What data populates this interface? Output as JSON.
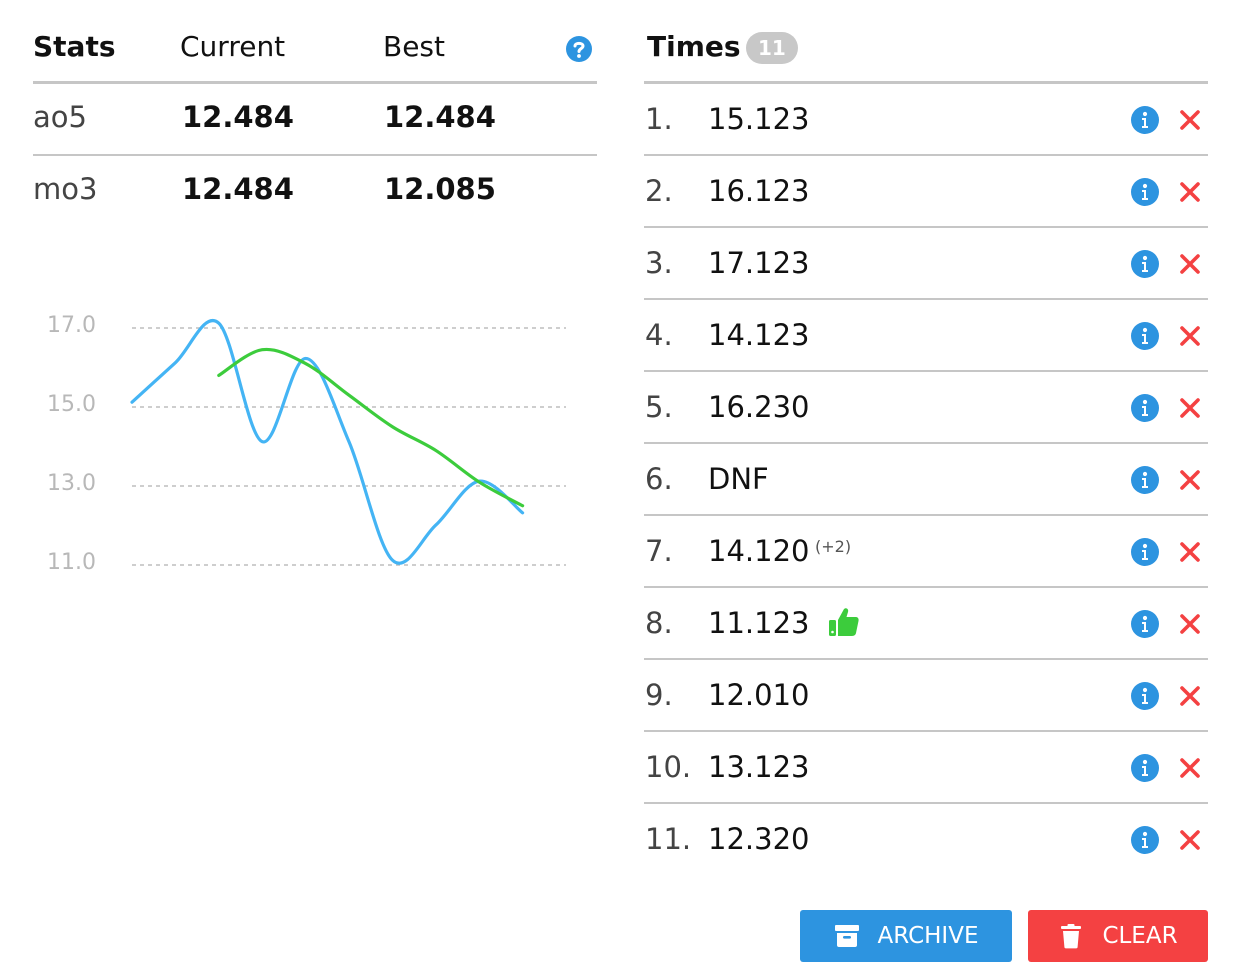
{
  "stats": {
    "headers": {
      "stats": "Stats",
      "current": "Current",
      "best": "Best"
    },
    "help_icon": "question-circle-icon",
    "rows": [
      {
        "label": "ao5",
        "current": "12.484",
        "best": "12.484"
      },
      {
        "label": "mo3",
        "current": "12.484",
        "best": "12.085"
      }
    ]
  },
  "chart_data": {
    "type": "line",
    "x": [
      1,
      2,
      3,
      4,
      5,
      6,
      7,
      8,
      9,
      10,
      11
    ],
    "series": [
      {
        "values": [
          15.123,
          16.123,
          17.123,
          14.123,
          16.23,
          14.12,
          11.123,
          12.01,
          13.123,
          12.32
        ],
        "color": "#44b4f4"
      },
      {
        "values": [
          15.8,
          16.45,
          16.1,
          15.3,
          14.5,
          13.9,
          13.1,
          12.5
        ],
        "color": "#3ccc3c"
      }
    ],
    "yticks": [
      "17.0",
      "15.0",
      "13.0",
      "11.0"
    ],
    "ylim": [
      11,
      17
    ],
    "grid": true
  },
  "times": {
    "title": "Times",
    "count": "11",
    "info_icon": "info-circle-icon",
    "delete_icon": "close-icon",
    "entries": [
      {
        "index": "1.",
        "value": "15.123"
      },
      {
        "index": "2.",
        "value": "16.123"
      },
      {
        "index": "3.",
        "value": "17.123"
      },
      {
        "index": "4.",
        "value": "14.123"
      },
      {
        "index": "5.",
        "value": "16.230"
      },
      {
        "index": "6.",
        "value": "DNF"
      },
      {
        "index": "7.",
        "value": "14.120",
        "penalty": "(+2)"
      },
      {
        "index": "8.",
        "value": "11.123",
        "icon": "thumbs-up-icon"
      },
      {
        "index": "9.",
        "value": "12.010"
      },
      {
        "index": "10.",
        "value": "13.123"
      },
      {
        "index": "11.",
        "value": "12.320"
      }
    ]
  },
  "buttons": {
    "archive": {
      "label": "ARCHIVE",
      "icon": "archive-icon",
      "color": "#2d94e0"
    },
    "clear": {
      "label": "CLEAR",
      "icon": "trash-icon",
      "color": "#f44142"
    }
  }
}
